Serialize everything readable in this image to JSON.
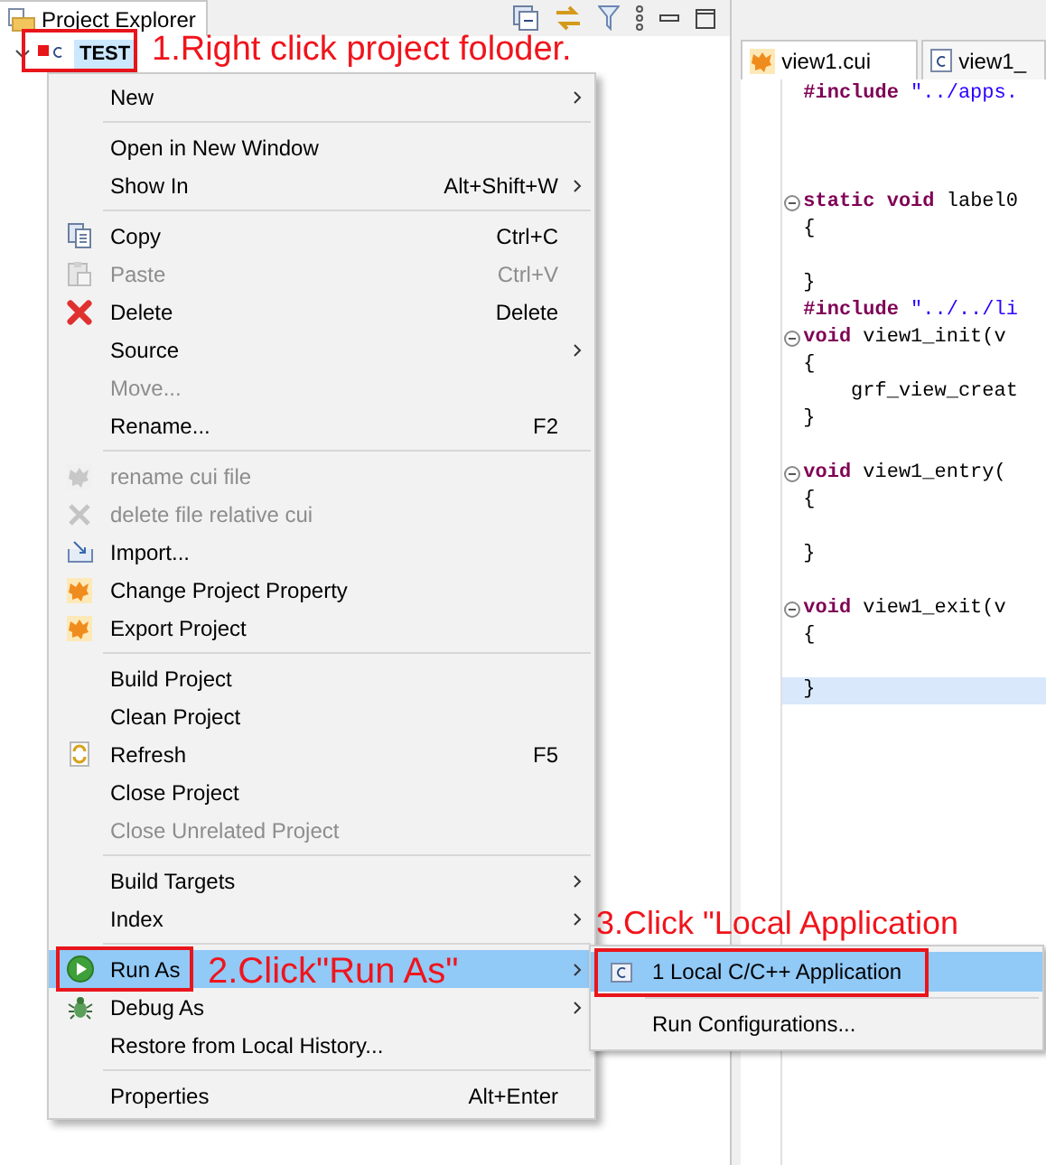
{
  "explorer": {
    "title": "Project Explorer",
    "tree": [
      {
        "label": "TEST",
        "expanded": true,
        "selected": true
      }
    ]
  },
  "editor": {
    "tabs": [
      {
        "label": "view1.cui",
        "selected": true
      },
      {
        "label": "view1_",
        "selected": false
      }
    ],
    "lines": [
      {
        "fold": false,
        "current": false,
        "tokens": [
          {
            "kind": "keyword",
            "text": "#include"
          },
          {
            "kind": "string",
            "text": " \"../apps."
          }
        ]
      },
      {
        "fold": false,
        "current": false
      },
      {
        "fold": false,
        "current": false
      },
      {
        "fold": false,
        "current": false
      },
      {
        "fold": true,
        "current": false,
        "tokens": [
          {
            "kind": "keyword",
            "text": "static void"
          },
          {
            "kind": "plain",
            "text": " label0"
          }
        ]
      },
      {
        "fold": false,
        "current": false,
        "tokens": [
          {
            "kind": "plain",
            "text": "{"
          }
        ]
      },
      {
        "fold": false,
        "current": false
      },
      {
        "fold": false,
        "current": false,
        "tokens": [
          {
            "kind": "plain",
            "text": "}"
          }
        ]
      },
      {
        "fold": false,
        "current": false,
        "tokens": [
          {
            "kind": "keyword",
            "text": "#include"
          },
          {
            "kind": "string",
            "text": " \"../../li"
          }
        ]
      },
      {
        "fold": true,
        "current": false,
        "tokens": [
          {
            "kind": "keyword",
            "text": "void"
          },
          {
            "kind": "plain",
            "text": " view1_init(v"
          }
        ]
      },
      {
        "fold": false,
        "current": false,
        "tokens": [
          {
            "kind": "plain",
            "text": "{"
          }
        ]
      },
      {
        "fold": false,
        "current": false,
        "tokens": [
          {
            "kind": "plain",
            "text": "    grf_view_creat"
          }
        ]
      },
      {
        "fold": false,
        "current": false,
        "tokens": [
          {
            "kind": "plain",
            "text": "}"
          }
        ]
      },
      {
        "fold": false,
        "current": false
      },
      {
        "fold": true,
        "current": false,
        "tokens": [
          {
            "kind": "keyword",
            "text": "void"
          },
          {
            "kind": "plain",
            "text": " view1_entry("
          }
        ]
      },
      {
        "fold": false,
        "current": false,
        "tokens": [
          {
            "kind": "plain",
            "text": "{"
          }
        ]
      },
      {
        "fold": false,
        "current": false
      },
      {
        "fold": false,
        "current": false,
        "tokens": [
          {
            "kind": "plain",
            "text": "}"
          }
        ]
      },
      {
        "fold": false,
        "current": false
      },
      {
        "fold": true,
        "current": false,
        "tokens": [
          {
            "kind": "keyword",
            "text": "void"
          },
          {
            "kind": "plain",
            "text": " view1_exit(v"
          }
        ]
      },
      {
        "fold": false,
        "current": false,
        "tokens": [
          {
            "kind": "plain",
            "text": "{"
          }
        ]
      },
      {
        "fold": false,
        "current": false
      },
      {
        "fold": false,
        "current": true,
        "tokens": [
          {
            "kind": "plain",
            "text": "}"
          }
        ]
      }
    ]
  },
  "context_menu": {
    "groups": [
      [
        {
          "label": "New",
          "submenu": true,
          "disabled": false,
          "selected": false
        }
      ],
      [
        {
          "label": "Open in New Window",
          "submenu": false,
          "disabled": false,
          "selected": false
        },
        {
          "label": "Show In",
          "shortcut": "Alt+Shift+W",
          "submenu": true,
          "disabled": false,
          "selected": false
        }
      ],
      [
        {
          "label": "Copy",
          "shortcut": "Ctrl+C",
          "submenu": false,
          "disabled": false,
          "selected": false
        },
        {
          "label": "Paste",
          "shortcut": "Ctrl+V",
          "submenu": false,
          "disabled": true,
          "selected": false
        },
        {
          "label": "Delete",
          "shortcut": "Delete",
          "submenu": false,
          "disabled": false,
          "selected": false
        },
        {
          "label": "Source",
          "submenu": true,
          "disabled": false,
          "selected": false
        },
        {
          "label": "Move...",
          "submenu": false,
          "disabled": true,
          "selected": false
        },
        {
          "label": "Rename...",
          "shortcut": "F2",
          "submenu": false,
          "disabled": false,
          "selected": false
        }
      ],
      [
        {
          "label": "rename cui file",
          "submenu": false,
          "disabled": true,
          "selected": false
        },
        {
          "label": "delete file relative cui",
          "submenu": false,
          "disabled": true,
          "selected": false
        },
        {
          "label": "Import...",
          "submenu": false,
          "disabled": false,
          "selected": false
        },
        {
          "label": "Change Project Property",
          "submenu": false,
          "disabled": false,
          "selected": false
        },
        {
          "label": "Export Project",
          "submenu": false,
          "disabled": false,
          "selected": false
        }
      ],
      [
        {
          "label": "Build Project",
          "submenu": false,
          "disabled": false,
          "selected": false
        },
        {
          "label": "Clean Project",
          "submenu": false,
          "disabled": false,
          "selected": false
        },
        {
          "label": "Refresh",
          "shortcut": "F5",
          "submenu": false,
          "disabled": false,
          "selected": false
        },
        {
          "label": "Close Project",
          "submenu": false,
          "disabled": false,
          "selected": false
        },
        {
          "label": "Close Unrelated Project",
          "submenu": false,
          "disabled": true,
          "selected": false
        }
      ],
      [
        {
          "label": "Build Targets",
          "submenu": true,
          "disabled": false,
          "selected": false
        },
        {
          "label": "Index",
          "submenu": true,
          "disabled": false,
          "selected": false
        }
      ],
      [
        {
          "label": "Run As",
          "submenu": true,
          "disabled": false,
          "selected": true
        },
        {
          "label": "Debug As",
          "submenu": true,
          "disabled": false,
          "selected": false
        },
        {
          "label": "Restore from Local History...",
          "submenu": false,
          "disabled": false,
          "selected": false
        }
      ],
      [
        {
          "label": "Properties",
          "shortcut": "Alt+Enter",
          "submenu": false,
          "disabled": false,
          "selected": false
        }
      ]
    ]
  },
  "run_as_submenu": {
    "groups": [
      [
        {
          "label": "1 Local C/C++ Application",
          "selected": true
        }
      ],
      [
        {
          "label": "Run Configurations...",
          "selected": false
        }
      ]
    ]
  },
  "annotations": [
    {
      "text": "1.Right click project foloder."
    },
    {
      "text": "2.Click\"Run As\""
    },
    {
      "text": "3.Click \"Local Application"
    }
  ]
}
